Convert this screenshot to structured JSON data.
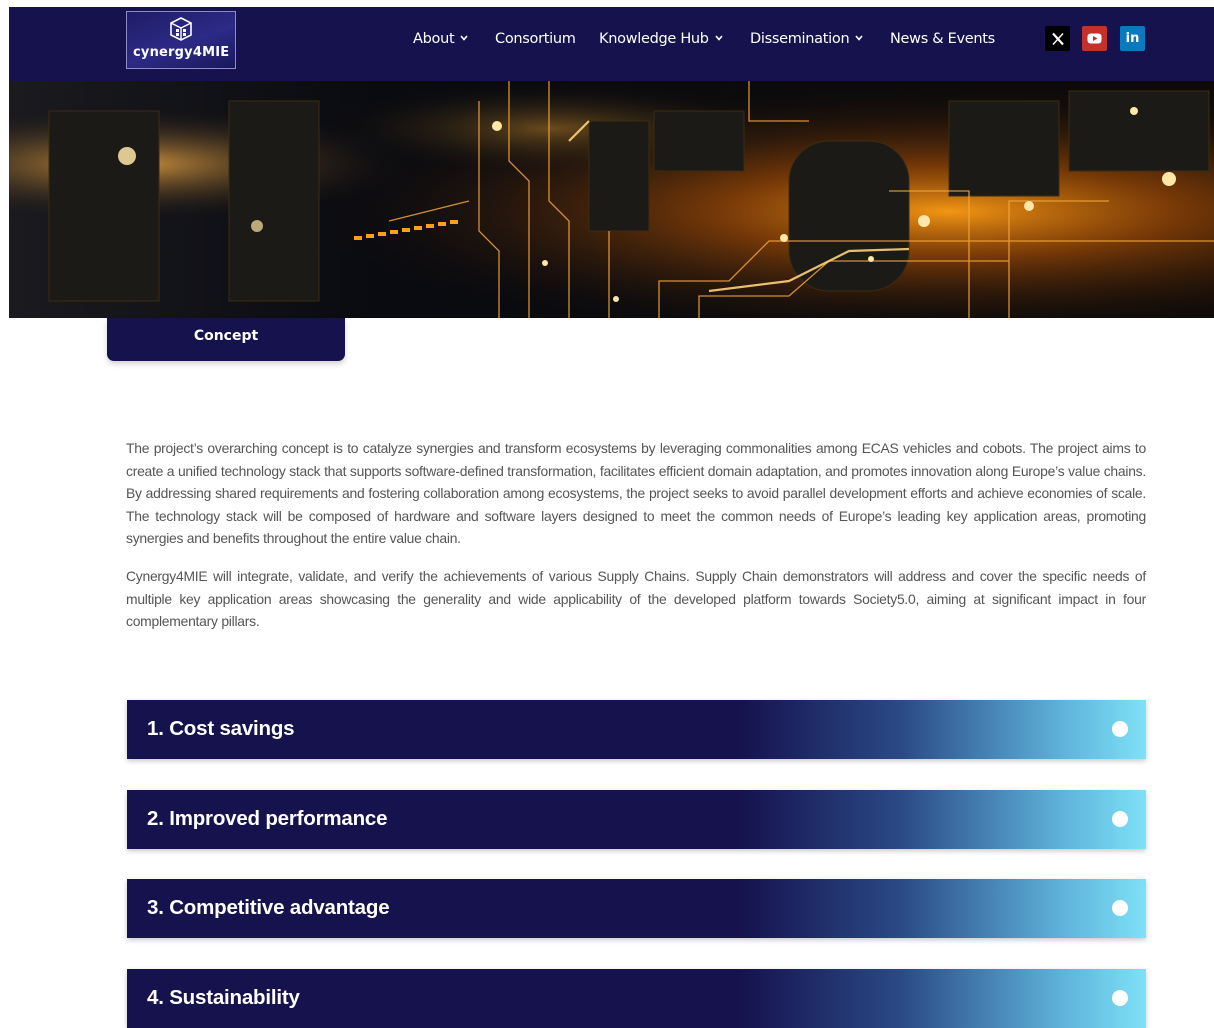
{
  "header": {
    "logo_text": "cynergy4MIE",
    "nav": [
      {
        "label": "About",
        "has_dropdown": true
      },
      {
        "label": "Consortium",
        "has_dropdown": false
      },
      {
        "label": "Knowledge Hub",
        "has_dropdown": true
      },
      {
        "label": "Dissemination",
        "has_dropdown": true
      },
      {
        "label": "News & Events",
        "has_dropdown": false
      }
    ],
    "social": [
      {
        "icon": "x-icon",
        "color": "#000000"
      },
      {
        "icon": "youtube-icon",
        "color": "#c4302b"
      },
      {
        "icon": "linkedin-icon",
        "color": "#0a7abf",
        "glyph": "in"
      }
    ]
  },
  "concept_tab": {
    "label": "Concept"
  },
  "content": {
    "paragraphs": [
      "The project’s overarching concept is to catalyze synergies and transform ecosystems by leveraging commonalities among ECAS vehicles and cobots. The project aims to create a unified technology stack that supports software-defined transformation, facilitates efficient domain adaptation, and promotes innovation along Europe’s value chains. By addressing shared requirements and fostering collaboration among ecosystems, the project seeks to avoid parallel development efforts and achieve economies of scale. The technology stack will be composed of hardware and software layers designed to meet the common needs of Europe’s leading key application areas, promoting synergies and benefits throughout the entire value chain.",
      "Cynergy4MIE will integrate, validate, and verify the achievements of various Supply Chains. Supply Chain demonstrators will address and cover the specific needs of multiple key application areas showcasing the generality and wide applicability of the developed platform towards Society5.0, aiming at significant impact in four complementary pillars."
    ]
  },
  "accordion": [
    {
      "title": "1. Cost savings"
    },
    {
      "title": "2. Improved performance"
    },
    {
      "title": "3. Competitive advantage"
    },
    {
      "title": "4. Sustainability"
    }
  ],
  "colors": {
    "navy": "#15124d",
    "accordion_gradient_end": "#7ee1f6",
    "hero_glow": "#ffa500"
  }
}
